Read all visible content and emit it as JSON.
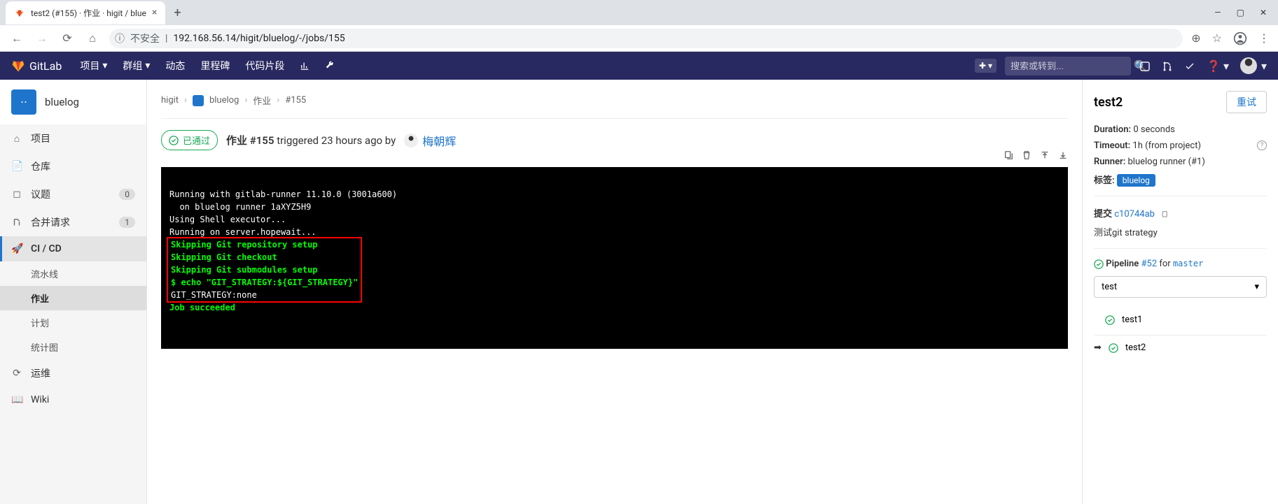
{
  "browser": {
    "tabTitle": "test2 (#155) · 作业 · higit / blue",
    "url": "192.168.56.14/higit/bluelog/-/jobs/155",
    "insecure": "不安全"
  },
  "topNav": {
    "brand": "GitLab",
    "items": [
      "项目",
      "群组",
      "动态",
      "里程碑",
      "代码片段"
    ],
    "searchPlaceholder": "搜索或转到..."
  },
  "sidebar": {
    "projectName": "bluelog",
    "items": {
      "project": "项目",
      "repo": "仓库",
      "issues": "议题",
      "issuesCount": "0",
      "merge": "合并请求",
      "mergeCount": "1",
      "cicd": "CI / CD",
      "ops": "运维",
      "wiki": "Wiki"
    },
    "subItems": {
      "pipelines": "流水线",
      "jobs": "作业",
      "schedules": "计划",
      "charts": "统计图"
    }
  },
  "breadcrumb": {
    "group": "higit",
    "project": "bluelog",
    "section": "作业",
    "id": "#155"
  },
  "jobHeader": {
    "status": "已通过",
    "title1": "作业",
    "jobId": "#155",
    "triggered": "triggered 23 hours ago by",
    "user": "梅朝辉"
  },
  "terminal": {
    "line1": "Running with gitlab-runner 11.10.0 (3001a600)",
    "line2": "  on bluelog runner 1aXYZ5H9",
    "line3": "Using Shell executor...",
    "line4": "Running on server.hopewait...",
    "line5": "Skipping Git repository setup",
    "line6": "Skipping Git checkout",
    "line7": "Skipping Git submodules setup",
    "line8": "$ echo \"GIT_STRATEGY:${GIT_STRATEGY}\"",
    "line9": "GIT_STRATEGY:none",
    "line10": "Job succeeded"
  },
  "rightPanel": {
    "title": "test2",
    "retry": "重试",
    "durationLabel": "Duration:",
    "duration": "0 seconds",
    "timeoutLabel": "Timeout:",
    "timeout": "1h (from project)",
    "runnerLabel": "Runner:",
    "runner": "bluelog runner (#1)",
    "tagLabel": "标签:",
    "tag": "bluelog",
    "commitLabel": "提交",
    "commitSha": "c10744ab",
    "commitMsg": "测试git strategy",
    "pipelineLabel": "Pipeline",
    "pipelineNum": "#52",
    "pipelineFor": "for",
    "pipelineBranch": "master",
    "stage": "test",
    "job1": "test1",
    "job2": "test2"
  }
}
